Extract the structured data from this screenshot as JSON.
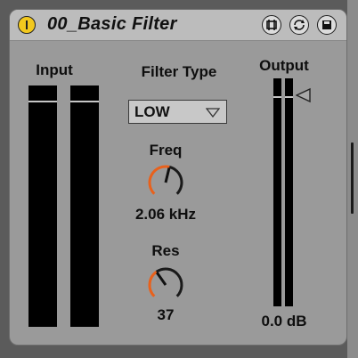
{
  "device": {
    "title": "00_Basic Filter",
    "icons": [
      "power-icon",
      "hot-swap-icon",
      "swap-presets-icon",
      "save-preset-icon"
    ]
  },
  "input": {
    "label": "Input"
  },
  "filter_type": {
    "label": "Filter Type",
    "selected": "LOW"
  },
  "freq": {
    "label": "Freq",
    "value": "2.06 kHz",
    "knob_fraction": 0.55
  },
  "res": {
    "label": "Res",
    "value": "37",
    "knob_fraction": 0.37
  },
  "output": {
    "label": "Output",
    "value": "0.0 dB"
  },
  "colors": {
    "accent": "#e8611c",
    "title_bar": "#bcbcbc",
    "body": "#9a9a9a",
    "power": "#f2c81e"
  }
}
